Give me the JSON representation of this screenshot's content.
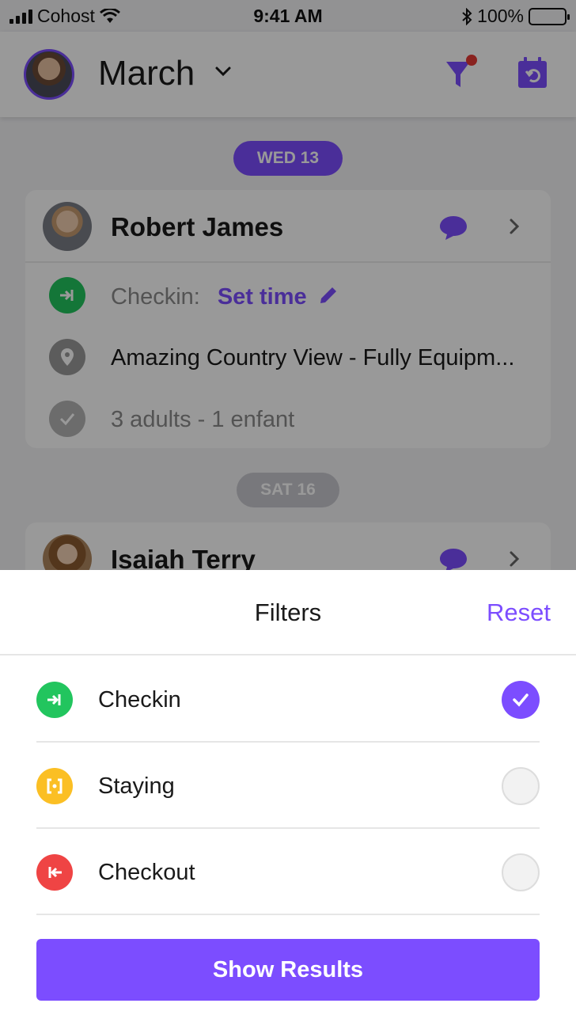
{
  "status_bar": {
    "carrier": "Cohost",
    "time": "9:41 AM",
    "battery": "100%"
  },
  "header": {
    "month": "March",
    "icons": [
      "avatar",
      "chevron-down-icon",
      "filter-icon",
      "calendar-reset-icon"
    ],
    "accent": "#7c4dff",
    "notification_dot": "#e53935"
  },
  "days": [
    {
      "date_label": "WED 13",
      "booking": {
        "guest": "Robert James",
        "checkin_label": "Checkin:",
        "checkin_action": "Set time",
        "property": "Amazing Country View - Fully Equipm...",
        "guests": "3 adults  - 1 enfant"
      }
    },
    {
      "date_label": "SAT 16",
      "booking": {
        "guest": "Isaiah Terry"
      }
    }
  ],
  "filters_sheet": {
    "title": "Filters",
    "reset_label": "Reset",
    "options": [
      {
        "label": "Checkin",
        "selected": true,
        "color": "#22c55e",
        "icon": "checkin-icon"
      },
      {
        "label": "Staying",
        "selected": false,
        "color": "#fbbf24",
        "icon": "staying-icon"
      },
      {
        "label": "Checkout",
        "selected": false,
        "color": "#ef4444",
        "icon": "checkout-icon"
      }
    ],
    "submit_label": "Show Results"
  }
}
